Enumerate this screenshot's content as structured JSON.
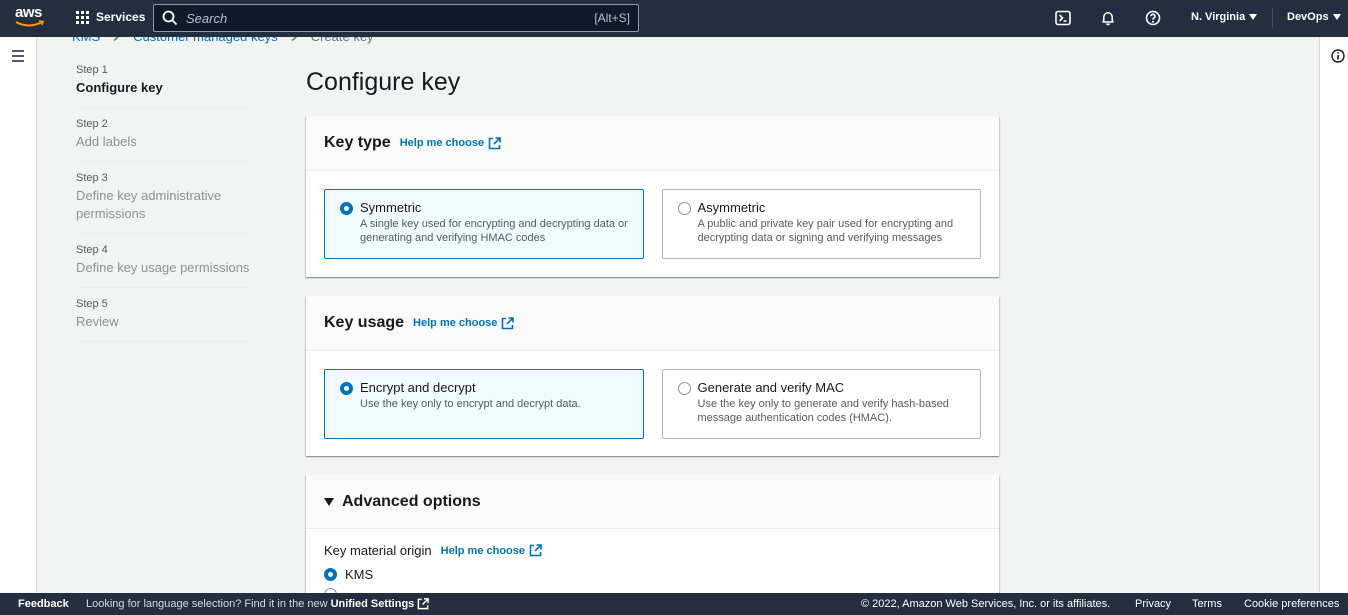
{
  "topnav": {
    "logo_text": "aws",
    "services_label": "Services",
    "search_placeholder": "Search",
    "search_shortcut": "[Alt+S]",
    "region_label": "N. Virginia",
    "account_label": "DevOps"
  },
  "breadcrumb": {
    "items": [
      "KMS",
      "Customer managed keys"
    ],
    "current": "Create key"
  },
  "steps": [
    {
      "num": "Step 1",
      "label": "Configure key"
    },
    {
      "num": "Step 2",
      "label": "Add labels"
    },
    {
      "num": "Step 3",
      "label": "Define key administrative permissions"
    },
    {
      "num": "Step 4",
      "label": "Define key usage permissions"
    },
    {
      "num": "Step 5",
      "label": "Review"
    }
  ],
  "page_title": "Configure key",
  "key_type": {
    "heading": "Key type",
    "help": "Help me choose",
    "options": [
      {
        "title": "Symmetric",
        "desc": "A single key used for encrypting and decrypting data or generating and verifying HMAC codes",
        "selected": true
      },
      {
        "title": "Asymmetric",
        "desc": "A public and private key pair used for encrypting and decrypting data or signing and verifying messages",
        "selected": false
      }
    ]
  },
  "key_usage": {
    "heading": "Key usage",
    "help": "Help me choose",
    "options": [
      {
        "title": "Encrypt and decrypt",
        "desc": "Use the key only to encrypt and decrypt data.",
        "selected": true
      },
      {
        "title": "Generate and verify MAC",
        "desc": "Use the key only to generate and verify hash-based message authentication codes (HMAC).",
        "selected": false
      }
    ]
  },
  "advanced": {
    "heading": "Advanced options",
    "origin_label": "Key material origin",
    "help": "Help me choose",
    "origin_option": "KMS"
  },
  "footer": {
    "feedback": "Feedback",
    "lang_text": "Looking for language selection? Find it in the new",
    "lang_link": "Unified Settings",
    "copyright": "© 2022, Amazon Web Services, Inc. or its affiliates.",
    "privacy": "Privacy",
    "terms": "Terms",
    "cookies": "Cookie preferences"
  },
  "colors": {
    "nav_bg": "#232f3e",
    "link": "#0073bb",
    "selected_bg": "#f1faff"
  }
}
